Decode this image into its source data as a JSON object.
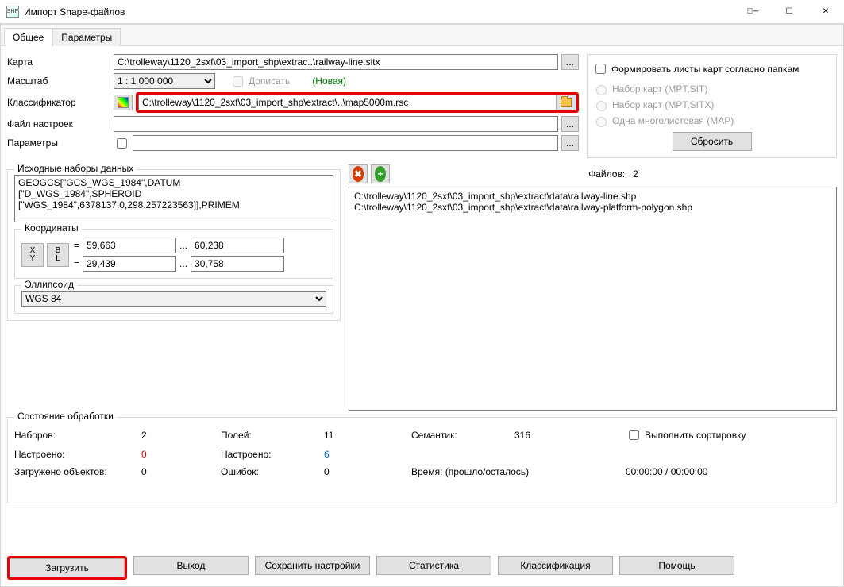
{
  "window": {
    "title": "Импорт Shape-файлов"
  },
  "tabs": {
    "general": "Общее",
    "params": "Параметры"
  },
  "labels": {
    "map": "Карта",
    "scale": "Масштаб",
    "classifier": "Классификатор",
    "settings_file": "Файл настроек",
    "parameters": "Параметры",
    "append": "Дописать",
    "new": "(Новая)"
  },
  "fields": {
    "map_path": "C:\\trolleway\\1120_2sxf\\03_import_shp\\extrac..\\railway-line.sitx",
    "scale": "1 : 1 000 000",
    "classifier_path": "C:\\trolleway\\1120_2sxf\\03_import_shp\\extract\\..\\map5000m.rsc",
    "settings_file": "",
    "parameters": ""
  },
  "right_panel": {
    "checkbox": "Формировать листы карт согласно папкам",
    "radio1": "Набор карт (MPT,SIT)",
    "radio2": "Набор карт (MPT,SITX)",
    "radio3": "Одна многолистовая (MAP)",
    "reset_btn": "Сбросить"
  },
  "source": {
    "title": "Исходные наборы данных",
    "geo_text": "GEOGCS[\"GCS_WGS_1984\",DATUM\n[\"D_WGS_1984\",SPHEROID\n[\"WGS_1984\",6378137.0,298.257223563]],PRIMEM",
    "coords_title": "Координаты",
    "xy_label_top": "X",
    "xy_label_bot": "Y",
    "bl_label_top": "B",
    "bl_label_bot": "L",
    "eq": "=",
    "x1": "59,663",
    "x2": "60,238",
    "y1": "29,439",
    "y2": "30,758",
    "dots": "...",
    "ellipsoid_title": "Эллипсоид",
    "ellipsoid": "WGS 84"
  },
  "files": {
    "count_label": "Файлов:",
    "count": "2",
    "list_text": "C:\\trolleway\\1120_2sxf\\03_import_shp\\extract\\data\\railway-line.shp\nC:\\trolleway\\1120_2sxf\\03_import_shp\\extract\\data\\railway-platform-polygon.shp"
  },
  "status": {
    "title": "Состояние обработки",
    "sets_lbl": "Наборов:",
    "sets_val": "2",
    "fields_lbl": "Полей:",
    "fields_val": "11",
    "sem_lbl": "Семантик:",
    "sem_val": "316",
    "sort_lbl": "Выполнить сортировку",
    "cfg_lbl": "Настроено:",
    "cfg_val": "0",
    "cfg2_lbl": "Настроено:",
    "cfg2_val": "6",
    "loaded_lbl": "Загружено объектов:",
    "loaded_val": "0",
    "err_lbl": "Ошибок:",
    "err_val": "0",
    "time_lbl": "Время: (прошло/осталось)",
    "time_val": "00:00:00 / 00:00:00"
  },
  "buttons": {
    "load": "Загрузить",
    "exit": "Выход",
    "save_settings": "Сохранить настройки",
    "stats": "Статистика",
    "classification": "Классификация",
    "help": "Помощь",
    "ellipsis": "..."
  }
}
